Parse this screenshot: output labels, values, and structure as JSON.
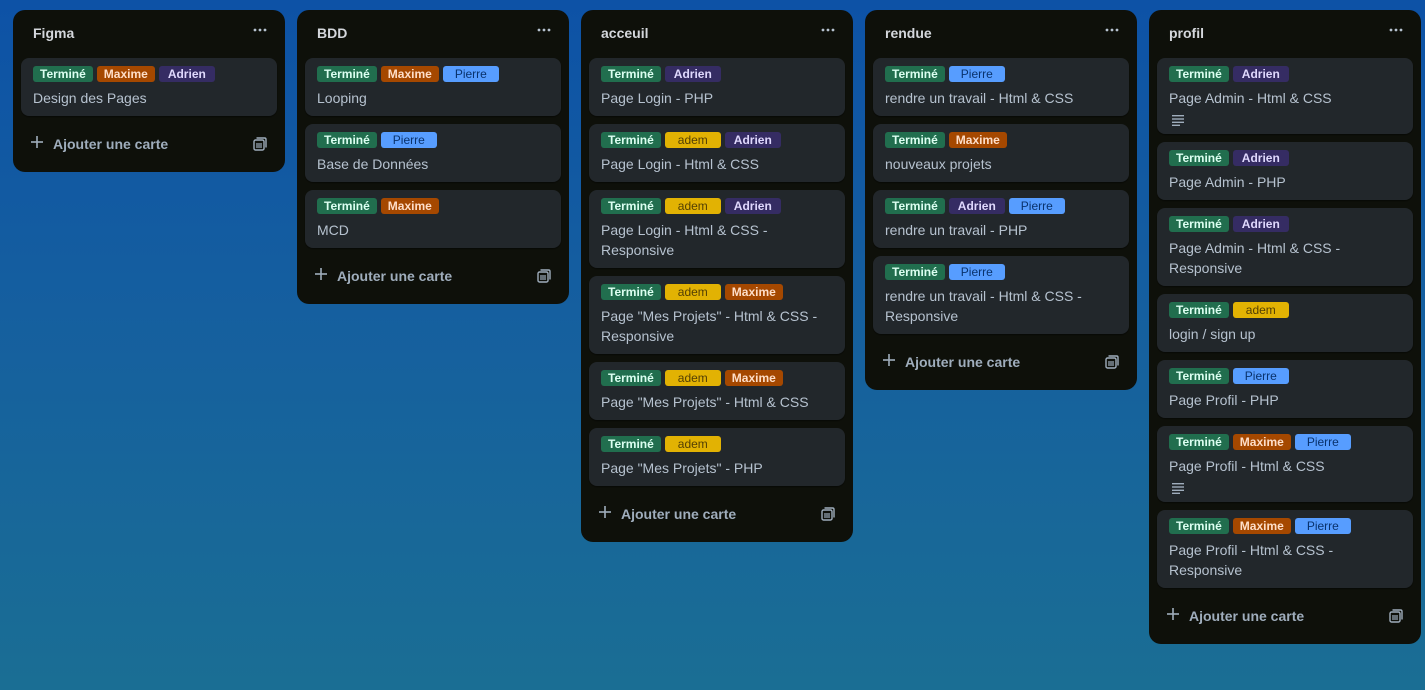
{
  "board": {
    "add_card_label": "Ajouter une carte",
    "lists": [
      {
        "title": "Figma",
        "cards": [
          {
            "title": "Design des Pages",
            "labels": [
              {
                "text": "Terminé",
                "color": "green"
              },
              {
                "text": "Maxime",
                "color": "orange"
              },
              {
                "text": "Adrien",
                "color": "purple"
              }
            ],
            "has_description": false
          }
        ]
      },
      {
        "title": "BDD",
        "cards": [
          {
            "title": "Looping",
            "labels": [
              {
                "text": "Terminé",
                "color": "green"
              },
              {
                "text": "Maxime",
                "color": "orange"
              },
              {
                "text": "Pierre",
                "color": "blue"
              }
            ],
            "has_description": false
          },
          {
            "title": "Base de Données",
            "labels": [
              {
                "text": "Terminé",
                "color": "green"
              },
              {
                "text": "Pierre",
                "color": "blue"
              }
            ],
            "has_description": false
          },
          {
            "title": "MCD",
            "labels": [
              {
                "text": "Terminé",
                "color": "green"
              },
              {
                "text": "Maxime",
                "color": "orange"
              }
            ],
            "has_description": false
          }
        ]
      },
      {
        "title": "acceuil",
        "cards": [
          {
            "title": "Page Login - PHP",
            "labels": [
              {
                "text": "Terminé",
                "color": "green"
              },
              {
                "text": "Adrien",
                "color": "purple"
              }
            ],
            "has_description": false
          },
          {
            "title": "Page Login - Html & CSS",
            "labels": [
              {
                "text": "Terminé",
                "color": "green"
              },
              {
                "text": "adem",
                "color": "yellow"
              },
              {
                "text": "Adrien",
                "color": "purple"
              }
            ],
            "has_description": false
          },
          {
            "title": "Page Login - Html & CSS - Responsive",
            "labels": [
              {
                "text": "Terminé",
                "color": "green"
              },
              {
                "text": "adem",
                "color": "yellow"
              },
              {
                "text": "Adrien",
                "color": "purple"
              }
            ],
            "has_description": false
          },
          {
            "title": "Page \"Mes Projets\" - Html & CSS - Responsive",
            "labels": [
              {
                "text": "Terminé",
                "color": "green"
              },
              {
                "text": "adem",
                "color": "yellow"
              },
              {
                "text": "Maxime",
                "color": "orange"
              }
            ],
            "has_description": false
          },
          {
            "title": "Page \"Mes Projets\" - Html & CSS",
            "labels": [
              {
                "text": "Terminé",
                "color": "green"
              },
              {
                "text": "adem",
                "color": "yellow"
              },
              {
                "text": "Maxime",
                "color": "orange"
              }
            ],
            "has_description": false
          },
          {
            "title": "Page \"Mes Projets\" - PHP",
            "labels": [
              {
                "text": "Terminé",
                "color": "green"
              },
              {
                "text": "adem",
                "color": "yellow"
              }
            ],
            "has_description": false
          }
        ]
      },
      {
        "title": "rendue",
        "cards": [
          {
            "title": "rendre un travail - Html & CSS",
            "labels": [
              {
                "text": "Terminé",
                "color": "green"
              },
              {
                "text": "Pierre",
                "color": "blue"
              }
            ],
            "has_description": false
          },
          {
            "title": "nouveaux projets",
            "labels": [
              {
                "text": "Terminé",
                "color": "green"
              },
              {
                "text": "Maxime",
                "color": "orange"
              }
            ],
            "has_description": false
          },
          {
            "title": "rendre un travail - PHP",
            "labels": [
              {
                "text": "Terminé",
                "color": "green"
              },
              {
                "text": "Adrien",
                "color": "purple"
              },
              {
                "text": "Pierre",
                "color": "blue"
              }
            ],
            "has_description": false
          },
          {
            "title": "rendre un travail - Html & CSS - Responsive",
            "labels": [
              {
                "text": "Terminé",
                "color": "green"
              },
              {
                "text": "Pierre",
                "color": "blue"
              }
            ],
            "has_description": false
          }
        ]
      },
      {
        "title": "profil",
        "cards": [
          {
            "title": "Page Admin - Html & CSS",
            "labels": [
              {
                "text": "Terminé",
                "color": "green"
              },
              {
                "text": "Adrien",
                "color": "purple"
              }
            ],
            "has_description": true
          },
          {
            "title": "Page Admin - PHP",
            "labels": [
              {
                "text": "Terminé",
                "color": "green"
              },
              {
                "text": "Adrien",
                "color": "purple"
              }
            ],
            "has_description": false
          },
          {
            "title": "Page Admin - Html & CSS - Responsive",
            "labels": [
              {
                "text": "Terminé",
                "color": "green"
              },
              {
                "text": "Adrien",
                "color": "purple"
              }
            ],
            "has_description": false
          },
          {
            "title": "login / sign up",
            "labels": [
              {
                "text": "Terminé",
                "color": "green"
              },
              {
                "text": "adem",
                "color": "yellow"
              }
            ],
            "has_description": false
          },
          {
            "title": "Page Profil - PHP",
            "labels": [
              {
                "text": "Terminé",
                "color": "green"
              },
              {
                "text": "Pierre",
                "color": "blue"
              }
            ],
            "has_description": false
          },
          {
            "title": "Page Profil - Html & CSS",
            "labels": [
              {
                "text": "Terminé",
                "color": "green"
              },
              {
                "text": "Maxime",
                "color": "orange"
              },
              {
                "text": "Pierre",
                "color": "blue"
              }
            ],
            "has_description": true
          },
          {
            "title": "Page Profil - Html & CSS - Responsive",
            "labels": [
              {
                "text": "Terminé",
                "color": "green"
              },
              {
                "text": "Maxime",
                "color": "orange"
              },
              {
                "text": "Pierre",
                "color": "blue"
              }
            ],
            "has_description": false
          }
        ]
      }
    ]
  },
  "colors": {
    "green": "#216e4e",
    "orange": "#a54800",
    "purple": "#352c63",
    "blue": "#579dff",
    "yellow": "#e2b203",
    "list_bg": "#0e100a",
    "card_bg": "#22272b"
  },
  "icons": {
    "list_menu": "ellipsis-icon",
    "add": "plus-icon",
    "template": "card-template-icon",
    "description": "description-lines-icon"
  }
}
